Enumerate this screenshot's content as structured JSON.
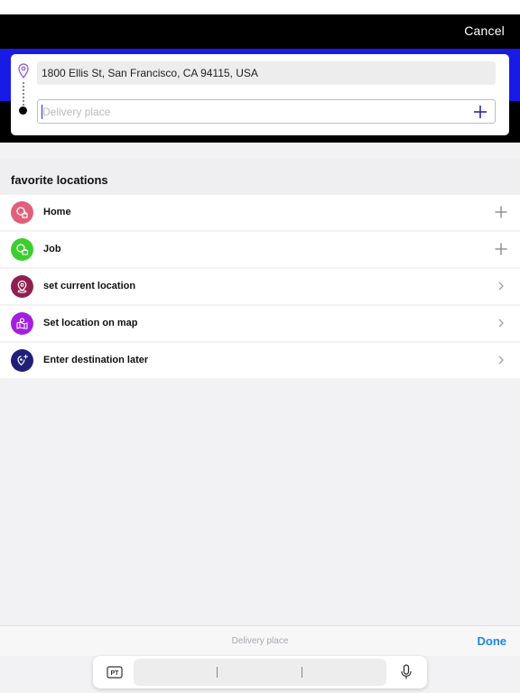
{
  "header": {
    "cancel_label": "Cancel"
  },
  "route": {
    "origin_value": "1800 Ellis St,  San Francisco,  CA 94115,  USA",
    "destination_placeholder": "Delivery place",
    "destination_value": ""
  },
  "favorites": {
    "title": "favorite locations",
    "items": [
      {
        "label": "Home",
        "icon": "home-pin-icon",
        "action": "plus-icon",
        "color": "#e0607a"
      },
      {
        "label": "Job",
        "icon": "briefcase-pin-icon",
        "action": "plus-icon",
        "color": "#3ccd2e"
      },
      {
        "label": "set current location",
        "icon": "location-pin-icon",
        "action": "chevron-right-icon",
        "color": "#8e2050"
      },
      {
        "label": "Set location on map",
        "icon": "map-icon",
        "action": "chevron-right-icon",
        "color": "#a31fe0"
      },
      {
        "label": "Enter destination later",
        "icon": "pin-plus-icon",
        "action": "chevron-right-icon",
        "color": "#1f1f7a"
      }
    ]
  },
  "bottom_bar": {
    "label": "Delivery place",
    "done_label": "Done"
  },
  "keyboard": {
    "language_label": "PT",
    "mic_icon": "microphone-icon"
  },
  "colors": {
    "header_black": "#000000",
    "header_blue": "#1a1ae6",
    "accent": "#1e88e5"
  }
}
